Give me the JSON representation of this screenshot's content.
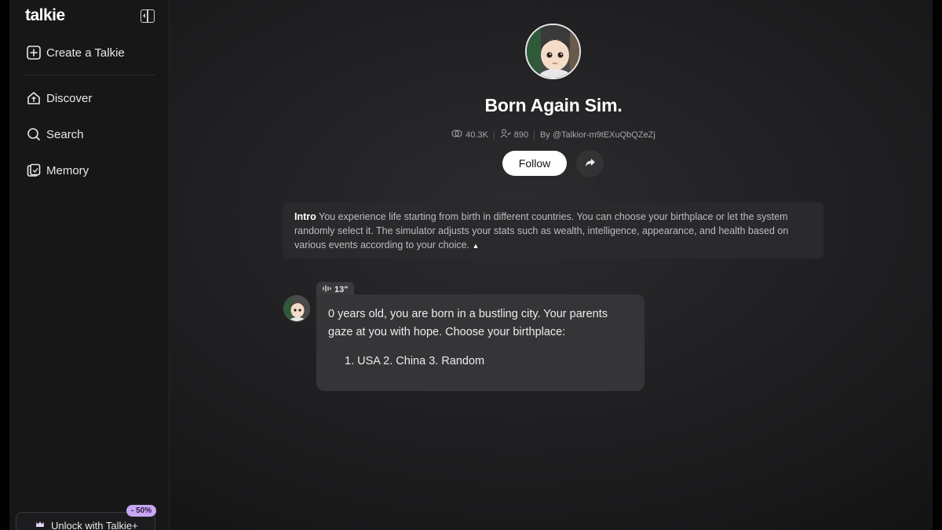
{
  "sidebar": {
    "logo": "talkie",
    "create_label": "Create a Talkie",
    "items": [
      {
        "label": "Discover",
        "icon": "home-t-icon"
      },
      {
        "label": "Search",
        "icon": "search-icon"
      },
      {
        "label": "Memory",
        "icon": "memory-card-icon"
      }
    ],
    "unlock_label": "Unlock with Talkie+",
    "discount_badge": "- 50%"
  },
  "profile": {
    "title": "Born Again Sim.",
    "views": "40.3K",
    "followers": "890",
    "author": "By @Talkior-m9tEXuQbQZeZj",
    "follow_label": "Follow"
  },
  "intro": {
    "heading": "Intro",
    "text": "You experience life starting from birth in different countries. You can choose your birthplace or let the system randomly select it. The simulator adjusts your stats such as wealth, intelligence, appearance, and health based on various events according to your choice."
  },
  "chat": {
    "voice_duration": "13\"",
    "message_line": "0 years old, you are born in a bustling city. Your parents gaze at you with hope. Choose your birthplace:",
    "options_line": "1. USA 2. China 3. Random"
  },
  "colors": {
    "background": "#1d1d1f",
    "sidebar": "#171718",
    "accent_badge": "#c9a6f5",
    "follow_button": "#ffffff"
  }
}
